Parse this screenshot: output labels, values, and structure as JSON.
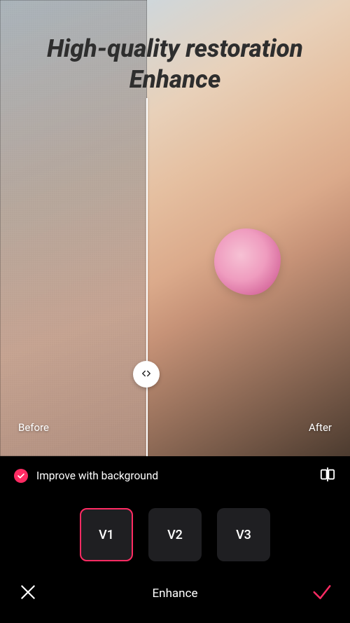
{
  "header": {
    "title_line1": "High-quality restoration",
    "title_line2": "Enhance"
  },
  "comparison": {
    "before_label": "Before",
    "after_label": "After",
    "slider_position_percent": 42
  },
  "option": {
    "checked": true,
    "label": "Improve with background"
  },
  "versions": {
    "items": [
      {
        "label": "V1",
        "active": true
      },
      {
        "label": "V2",
        "active": false
      },
      {
        "label": "V3",
        "active": false
      }
    ]
  },
  "footer": {
    "title": "Enhance"
  },
  "colors": {
    "accent": "#ff2b63",
    "panel_bg": "#000000",
    "version_bg": "#1f1f22"
  },
  "icons": {
    "slider_handle": "slider-handle-icon",
    "checkmark": "check-icon",
    "compare": "compare-icon",
    "close": "close-icon",
    "apply": "apply-icon"
  }
}
